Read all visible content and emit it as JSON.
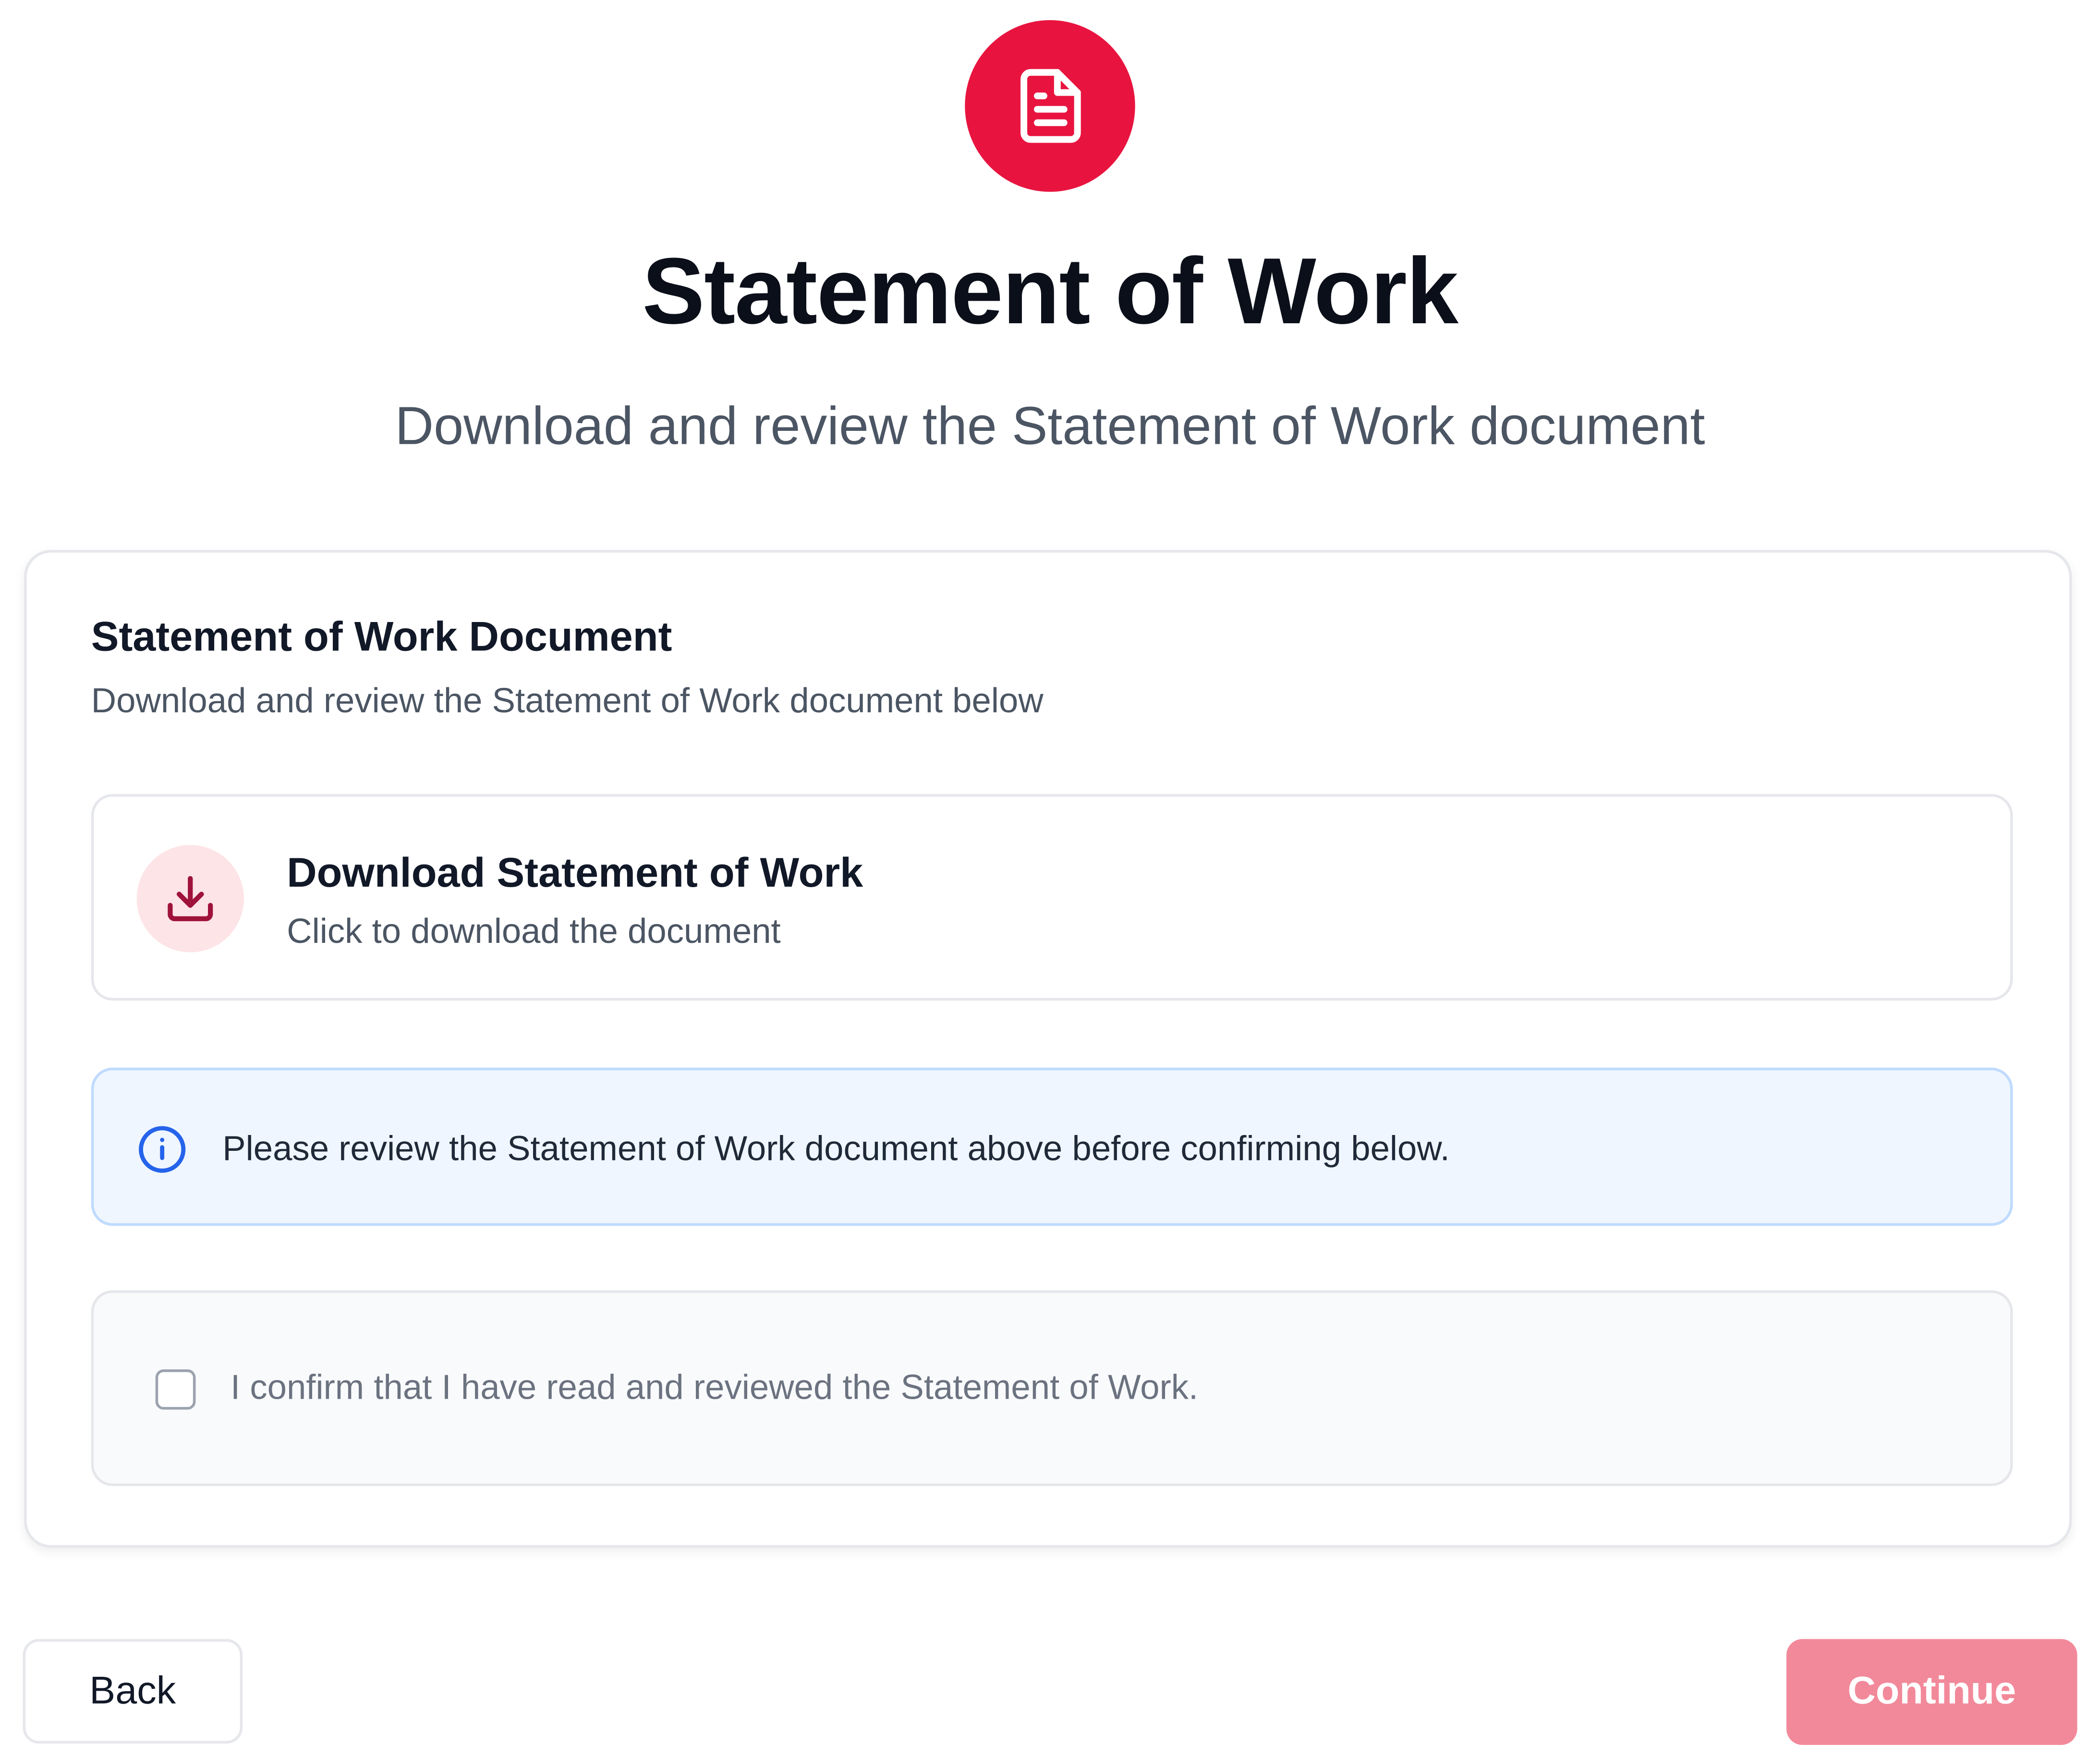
{
  "header": {
    "icon": "document-icon",
    "title": "Statement of Work",
    "subtitle": "Download and review the Statement of Work document"
  },
  "card": {
    "title": "Statement of Work Document",
    "description": "Download and review the Statement of Work document below",
    "download": {
      "icon": "download-icon",
      "title": "Download Statement of Work",
      "subtitle": "Click to download the document"
    },
    "info": {
      "icon": "info-icon",
      "text": "Please review the Statement of Work document above before confirming below."
    },
    "confirm": {
      "checked": false,
      "label": "I confirm that I have read and reviewed the Statement of Work."
    }
  },
  "footer": {
    "back_label": "Back",
    "continue_label": "Continue"
  },
  "colors": {
    "accent": "#e8143f",
    "accent_soft": "#fde4e6",
    "info_bg": "#eff6ff",
    "info_icon": "#2563eb",
    "continue_disabled": "#f2899a"
  }
}
